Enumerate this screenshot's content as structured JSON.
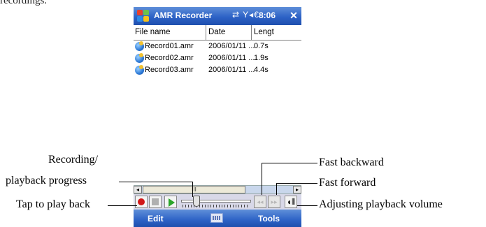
{
  "caption_top": "recordings.",
  "app": {
    "title": "AMR Recorder",
    "status_icons": "⇄ Y◂€",
    "clock": "8:06",
    "close": "✕"
  },
  "columns": [
    "File name",
    "Date",
    "Lengt"
  ],
  "files": [
    {
      "name": "Record01.amr",
      "date": "2006/01/11 ...",
      "length": "0.7s"
    },
    {
      "name": "Record02.amr",
      "date": "2006/01/11 ...",
      "length": "1.9s"
    },
    {
      "name": "Record03.amr",
      "date": "2006/01/11 ...",
      "length": "4.4s"
    }
  ],
  "scrollbar": {
    "left": "◂",
    "thumb": "III",
    "right": "▸"
  },
  "player": {
    "progress": 0.22,
    "rew_glyph": "◂◂",
    "fwd_glyph": "▸▸",
    "volume_glyph": "◖⦀"
  },
  "menu": {
    "left": "Edit",
    "right": "Tools"
  },
  "annotations": {
    "recording_progress_line1": "Recording/",
    "recording_progress_line2": "playback progress",
    "tap_to_play": "Tap to play back",
    "fast_backward": "Fast backward",
    "fast_forward": "Fast forward",
    "volume": "Adjusting playback volume"
  },
  "colors": {
    "titlebar": "#2d62c6",
    "record": "#d01818",
    "play": "#2aa52a"
  }
}
